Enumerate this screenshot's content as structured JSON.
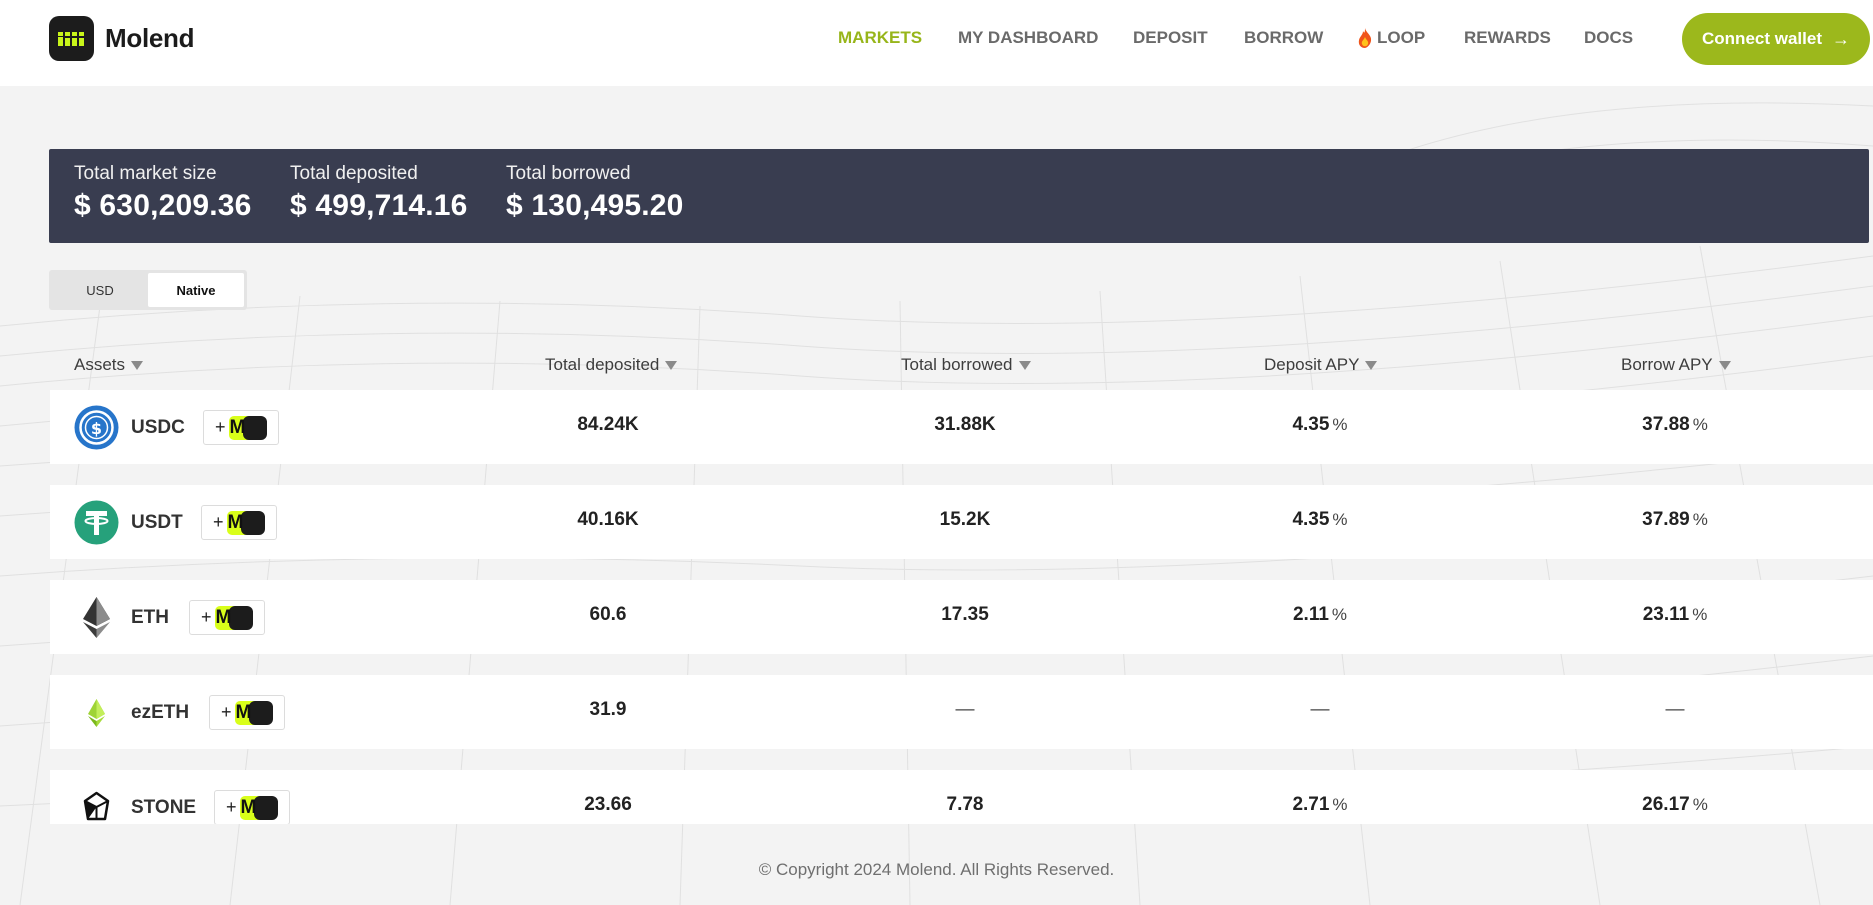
{
  "brand": {
    "name": "Molend"
  },
  "nav": {
    "items": [
      {
        "label": "MARKETS",
        "active": true
      },
      {
        "label": "MY DASHBOARD"
      },
      {
        "label": "DEPOSIT"
      },
      {
        "label": "BORROW"
      },
      {
        "label": "LOOP",
        "icon": "flame-icon"
      },
      {
        "label": "REWARDS"
      },
      {
        "label": "DOCS"
      }
    ],
    "connect_label": "Connect wallet",
    "connect_arrow": "→"
  },
  "stats": {
    "market_size_label": "Total market size",
    "market_size_value": "$ 630,209.36",
    "deposited_label": "Total deposited",
    "deposited_value": "$ 499,714.16",
    "borrowed_label": "Total borrowed",
    "borrowed_value": "$ 130,495.20"
  },
  "toggle": {
    "usd": "USD",
    "native": "Native",
    "selected": "Native"
  },
  "table": {
    "headers": {
      "assets": "Assets",
      "total_deposited": "Total deposited",
      "total_borrowed": "Total borrowed",
      "deposit_apy": "Deposit APY",
      "borrow_apy": "Borrow APY"
    },
    "pct_unit": "%",
    "badge_plus": "+",
    "badge_letter": "M",
    "rows": [
      {
        "asset": "USDC",
        "icon": "usdc-icon",
        "deposited": "84.24K",
        "borrowed": "31.88K",
        "deposit_apy": "4.35",
        "borrow_apy": "37.88"
      },
      {
        "asset": "USDT",
        "icon": "usdt-icon",
        "deposited": "40.16K",
        "borrowed": "15.2K",
        "deposit_apy": "4.35",
        "borrow_apy": "37.89"
      },
      {
        "asset": "ETH",
        "icon": "eth-icon",
        "deposited": "60.6",
        "borrowed": "17.35",
        "deposit_apy": "2.11",
        "borrow_apy": "23.11"
      },
      {
        "asset": "ezETH",
        "icon": "ezeth-icon",
        "deposited": "31.9",
        "borrowed": "—",
        "deposit_apy": "—",
        "borrow_apy": "—"
      },
      {
        "asset": "STONE",
        "icon": "stone-icon",
        "deposited": "23.66",
        "borrowed": "7.78",
        "deposit_apy": "2.71",
        "borrow_apy": "26.17"
      }
    ]
  },
  "footer": {
    "copyright": "© Copyright 2024 Molend. All Rights Reserved."
  },
  "colors": {
    "accent": "#9cb81c",
    "active_nav": "#97b51a",
    "banner": "#393d50",
    "badge_lime": "#d9ff1a"
  }
}
